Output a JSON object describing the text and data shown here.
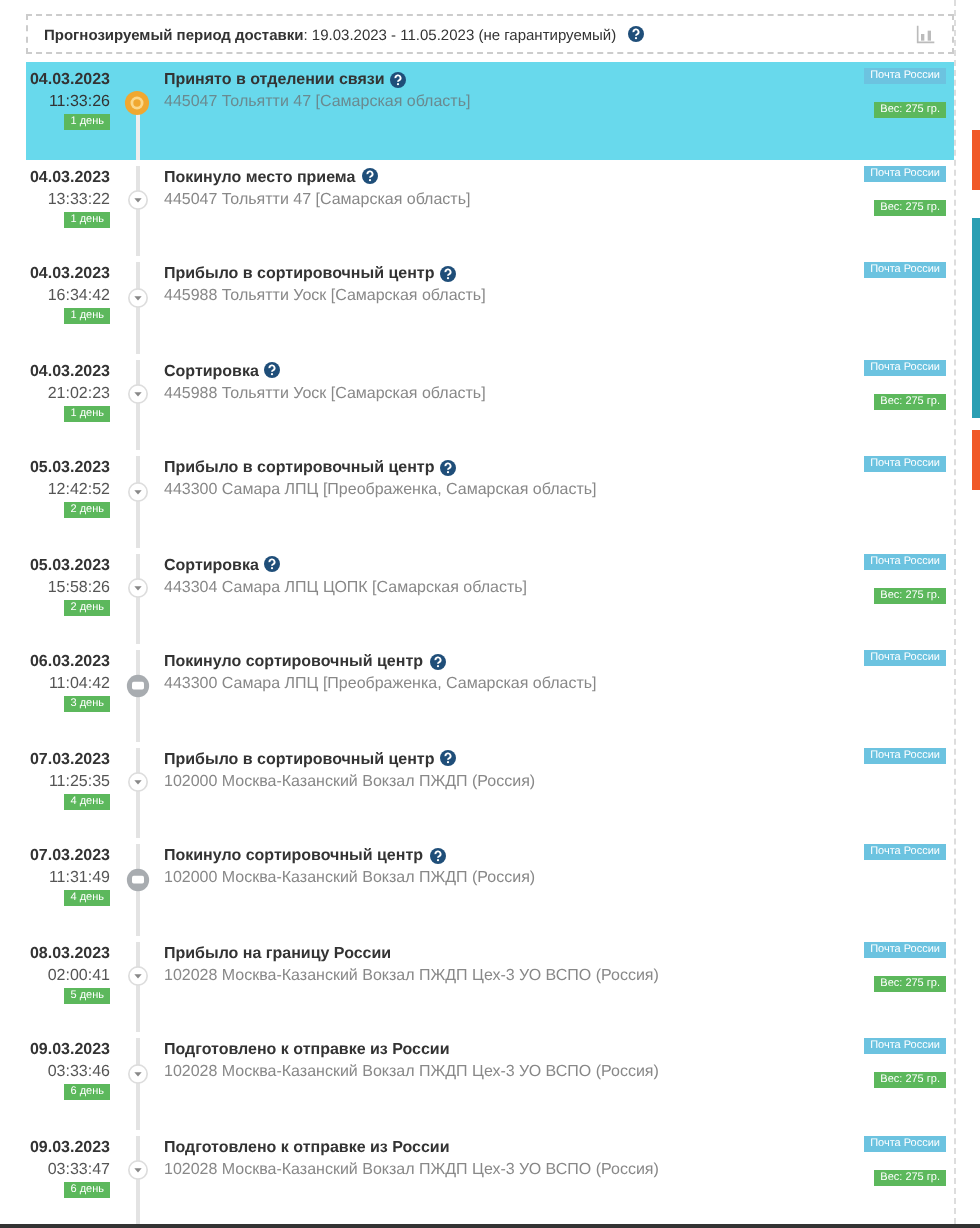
{
  "forecast": {
    "text": "**Прогнозируемый период доставки**: 19.03.2023 - 11.05.2023 (не гарантируемый)",
    "help": true
  },
  "events": [
    {
      "date": "04.03.2023",
      "time": "11:33:26",
      "day": "1 день",
      "title": "Принято в отделении связи",
      "help": true,
      "address": "445047 Тольятти 47 [Самарская область]",
      "carrier": "Почта России",
      "weight": "Вес: 275 гр.",
      "kind": "accepted",
      "selected": true
    },
    {
      "date": "04.03.2023",
      "time": "13:33:22",
      "day": "1 день",
      "title": "Покинуло место приема",
      "help": true,
      "address": "445047 Тольятти 47 [Самарская область]",
      "carrier": "Почта России",
      "weight": "Вес: 275 гр.",
      "kind": "arrow",
      "selected": false
    },
    {
      "date": "04.03.2023",
      "time": "16:34:42",
      "day": "1 день",
      "title": "Прибыло в сортировочный центр",
      "help": true,
      "address": "445988 Тольятти Уоск [Самарская область]",
      "carrier": "Почта России",
      "kind": "arrow",
      "selected": false
    },
    {
      "date": "04.03.2023",
      "time": "21:02:23",
      "day": "1 день",
      "title": "Сортировка",
      "help": true,
      "address": "445988 Тольятти Уоск [Самарская область]",
      "carrier": "Почта России",
      "weight": "Вес: 275 гр.",
      "kind": "arrow",
      "selected": false
    },
    {
      "date": "05.03.2023",
      "time": "12:42:52",
      "day": "2 день",
      "title": "Прибыло в сортировочный центр",
      "help": true,
      "address": "443300 Самара ЛПЦ [Преображенка, Самарская область]",
      "carrier": "Почта России",
      "kind": "arrow",
      "selected": false
    },
    {
      "date": "05.03.2023",
      "time": "15:58:26",
      "day": "2 день",
      "title": "Сортировка",
      "help": true,
      "address": "443304 Самара ЛПЦ ЦОПК [Самарская область]",
      "carrier": "Почта России",
      "weight": "Вес: 275 гр.",
      "kind": "arrow",
      "selected": false
    },
    {
      "date": "06.03.2023",
      "time": "11:04:42",
      "day": "3 день",
      "title": "Покинуло сортировочный центр",
      "help": true,
      "address": "443300 Самара ЛПЦ [Преображенка, Самарская область]",
      "carrier": "Почта России",
      "kind": "vehicle",
      "selected": false
    },
    {
      "date": "07.03.2023",
      "time": "11:25:35",
      "day": "4 день",
      "title": "Прибыло в сортировочный центр",
      "help": true,
      "address": "102000 Москва-Казанский Вокзал ПЖДП (Россия)",
      "carrier": "Почта России",
      "kind": "arrow",
      "selected": false
    },
    {
      "date": "07.03.2023",
      "time": "11:31:49",
      "day": "4 день",
      "title": "Покинуло сортировочный центр",
      "help": true,
      "address": "102000 Москва-Казанский Вокзал ПЖДП (Россия)",
      "carrier": "Почта России",
      "kind": "vehicle",
      "selected": false
    },
    {
      "date": "08.03.2023",
      "time": "02:00:41",
      "day": "5 день",
      "title": "Прибыло на границу России",
      "help": false,
      "address": "102028 Москва-Казанский Вокзал ПЖДП Цех-3 УО ВСПО (Россия)",
      "carrier": "Почта России",
      "weight": "Вес: 275 гр.",
      "kind": "arrow",
      "selected": false
    },
    {
      "date": "09.03.2023",
      "time": "03:33:46",
      "day": "6 день",
      "title": "Подготовлено к отправке из России",
      "help": false,
      "address": "102028 Москва-Казанский Вокзал ПЖДП Цех-3 УО ВСПО (Россия)",
      "carrier": "Почта России",
      "weight": "Вес: 275 гр.",
      "kind": "arrow",
      "selected": false
    },
    {
      "date": "09.03.2023",
      "time": "03:33:47",
      "day": "6 день",
      "title": "Подготовлено к отправке из России",
      "help": false,
      "address": "102028 Москва-Казанский Вокзал ПЖДП Цех-3 УО ВСПО (Россия)",
      "carrier": "Почта России",
      "weight": "Вес: 275 гр.",
      "kind": "arrow",
      "selected": false
    }
  ]
}
